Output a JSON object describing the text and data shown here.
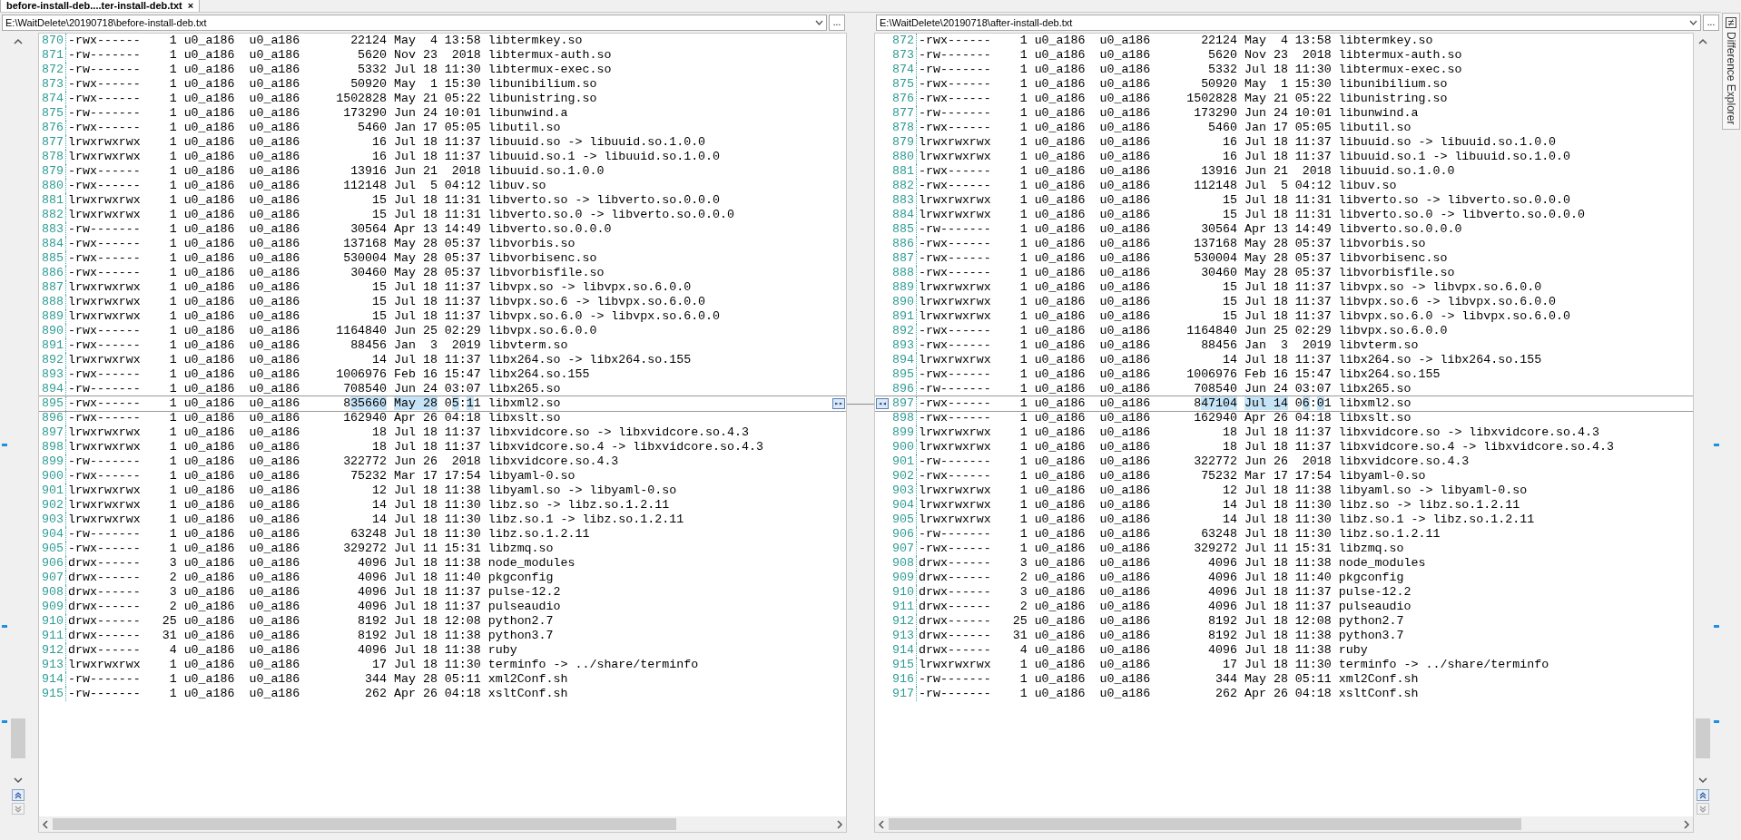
{
  "tab": {
    "title": "before-install-deb....ter-install-deb.txt",
    "close": "×",
    "selected": true
  },
  "panes": [
    {
      "path": "E:\\WaitDelete\\20190718\\before-install-deb.txt",
      "browse": "...",
      "rows": [
        {
          "n": "870",
          "perms": "-rwx------",
          "links": "1",
          "owner": "u0_a186",
          "group": "u0_a186",
          "size": "22124",
          "date": "May  4 13:58",
          "name": "libtermkey.so"
        },
        {
          "n": "871",
          "perms": "-rw-------",
          "links": "1",
          "owner": "u0_a186",
          "group": "u0_a186",
          "size": "5620",
          "date": "Nov 23  2018",
          "name": "libtermux-auth.so"
        },
        {
          "n": "872",
          "perms": "-rw-------",
          "links": "1",
          "owner": "u0_a186",
          "group": "u0_a186",
          "size": "5332",
          "date": "Jul 18 11:30",
          "name": "libtermux-exec.so"
        },
        {
          "n": "873",
          "perms": "-rwx------",
          "links": "1",
          "owner": "u0_a186",
          "group": "u0_a186",
          "size": "50920",
          "date": "May  1 15:30",
          "name": "libunibilium.so"
        },
        {
          "n": "874",
          "perms": "-rwx------",
          "links": "1",
          "owner": "u0_a186",
          "group": "u0_a186",
          "size": "1502828",
          "date": "May 21 05:22",
          "name": "libunistring.so"
        },
        {
          "n": "875",
          "perms": "-rw-------",
          "links": "1",
          "owner": "u0_a186",
          "group": "u0_a186",
          "size": "173290",
          "date": "Jun 24 10:01",
          "name": "libunwind.a"
        },
        {
          "n": "876",
          "perms": "-rwx------",
          "links": "1",
          "owner": "u0_a186",
          "group": "u0_a186",
          "size": "5460",
          "date": "Jan 17 05:05",
          "name": "libutil.so"
        },
        {
          "n": "877",
          "perms": "lrwxrwxrwx",
          "links": "1",
          "owner": "u0_a186",
          "group": "u0_a186",
          "size": "16",
          "date": "Jul 18 11:37",
          "name": "libuuid.so -> libuuid.so.1.0.0"
        },
        {
          "n": "878",
          "perms": "lrwxrwxrwx",
          "links": "1",
          "owner": "u0_a186",
          "group": "u0_a186",
          "size": "16",
          "date": "Jul 18 11:37",
          "name": "libuuid.so.1 -> libuuid.so.1.0.0"
        },
        {
          "n": "879",
          "perms": "-rwx------",
          "links": "1",
          "owner": "u0_a186",
          "group": "u0_a186",
          "size": "13916",
          "date": "Jun 21  2018",
          "name": "libuuid.so.1.0.0"
        },
        {
          "n": "880",
          "perms": "-rwx------",
          "links": "1",
          "owner": "u0_a186",
          "group": "u0_a186",
          "size": "112148",
          "date": "Jul  5 04:12",
          "name": "libuv.so"
        },
        {
          "n": "881",
          "perms": "lrwxrwxrwx",
          "links": "1",
          "owner": "u0_a186",
          "group": "u0_a186",
          "size": "15",
          "date": "Jul 18 11:31",
          "name": "libverto.so -> libverto.so.0.0.0"
        },
        {
          "n": "882",
          "perms": "lrwxrwxrwx",
          "links": "1",
          "owner": "u0_a186",
          "group": "u0_a186",
          "size": "15",
          "date": "Jul 18 11:31",
          "name": "libverto.so.0 -> libverto.so.0.0.0"
        },
        {
          "n": "883",
          "perms": "-rw-------",
          "links": "1",
          "owner": "u0_a186",
          "group": "u0_a186",
          "size": "30564",
          "date": "Apr 13 14:49",
          "name": "libverto.so.0.0.0"
        },
        {
          "n": "884",
          "perms": "-rwx------",
          "links": "1",
          "owner": "u0_a186",
          "group": "u0_a186",
          "size": "137168",
          "date": "May 28 05:37",
          "name": "libvorbis.so"
        },
        {
          "n": "885",
          "perms": "-rwx------",
          "links": "1",
          "owner": "u0_a186",
          "group": "u0_a186",
          "size": "530004",
          "date": "May 28 05:37",
          "name": "libvorbisenc.so"
        },
        {
          "n": "886",
          "perms": "-rwx------",
          "links": "1",
          "owner": "u0_a186",
          "group": "u0_a186",
          "size": "30460",
          "date": "May 28 05:37",
          "name": "libvorbisfile.so"
        },
        {
          "n": "887",
          "perms": "lrwxrwxrwx",
          "links": "1",
          "owner": "u0_a186",
          "group": "u0_a186",
          "size": "15",
          "date": "Jul 18 11:37",
          "name": "libvpx.so -> libvpx.so.6.0.0"
        },
        {
          "n": "888",
          "perms": "lrwxrwxrwx",
          "links": "1",
          "owner": "u0_a186",
          "group": "u0_a186",
          "size": "15",
          "date": "Jul 18 11:37",
          "name": "libvpx.so.6 -> libvpx.so.6.0.0"
        },
        {
          "n": "889",
          "perms": "lrwxrwxrwx",
          "links": "1",
          "owner": "u0_a186",
          "group": "u0_a186",
          "size": "15",
          "date": "Jul 18 11:37",
          "name": "libvpx.so.6.0 -> libvpx.so.6.0.0"
        },
        {
          "n": "890",
          "perms": "-rwx------",
          "links": "1",
          "owner": "u0_a186",
          "group": "u0_a186",
          "size": "1164840",
          "date": "Jun 25 02:29",
          "name": "libvpx.so.6.0.0"
        },
        {
          "n": "891",
          "perms": "-rwx------",
          "links": "1",
          "owner": "u0_a186",
          "group": "u0_a186",
          "size": "88456",
          "date": "Jan  3  2019",
          "name": "libvterm.so"
        },
        {
          "n": "892",
          "perms": "lrwxrwxrwx",
          "links": "1",
          "owner": "u0_a186",
          "group": "u0_a186",
          "size": "14",
          "date": "Jul 18 11:37",
          "name": "libx264.so -> libx264.so.155"
        },
        {
          "n": "893",
          "perms": "-rwx------",
          "links": "1",
          "owner": "u0_a186",
          "group": "u0_a186",
          "size": "1006976",
          "date": "Feb 16 15:47",
          "name": "libx264.so.155"
        },
        {
          "n": "894",
          "perms": "-rw-------",
          "links": "1",
          "owner": "u0_a186",
          "group": "u0_a186",
          "size": "708540",
          "date": "Jun 24 03:07",
          "name": "libx265.so"
        },
        {
          "n": "895",
          "perms": "-rwx------",
          "links": "1",
          "owner": "u0_a186",
          "group": "u0_a186",
          "changed": true,
          "size": [
            {
              "text": "8",
              "changed": false
            },
            {
              "text": "35660",
              "changed": true
            }
          ],
          "date": [
            {
              "text": "May 28",
              "changed": true
            },
            {
              "text": " 0",
              "changed": false
            },
            {
              "text": "5",
              "changed": true
            },
            {
              "text": ":",
              "changed": false
            },
            {
              "text": "1",
              "changed": true
            },
            {
              "text": "1",
              "changed": false
            }
          ],
          "name": "libxml2.so",
          "jump": "▸▸"
        },
        {
          "n": "896",
          "perms": "-rwx------",
          "links": "1",
          "owner": "u0_a186",
          "group": "u0_a186",
          "size": "162940",
          "date": "Apr 26 04:18",
          "name": "libxslt.so"
        },
        {
          "n": "897",
          "perms": "lrwxrwxrwx",
          "links": "1",
          "owner": "u0_a186",
          "group": "u0_a186",
          "size": "18",
          "date": "Jul 18 11:37",
          "name": "libxvidcore.so -> libxvidcore.so.4.3"
        },
        {
          "n": "898",
          "perms": "lrwxrwxrwx",
          "links": "1",
          "owner": "u0_a186",
          "group": "u0_a186",
          "size": "18",
          "date": "Jul 18 11:37",
          "name": "libxvidcore.so.4 -> libxvidcore.so.4.3"
        },
        {
          "n": "899",
          "perms": "-rw-------",
          "links": "1",
          "owner": "u0_a186",
          "group": "u0_a186",
          "size": "322772",
          "date": "Jun 26  2018",
          "name": "libxvidcore.so.4.3"
        },
        {
          "n": "900",
          "perms": "-rwx------",
          "links": "1",
          "owner": "u0_a186",
          "group": "u0_a186",
          "size": "75232",
          "date": "Mar 17 17:54",
          "name": "libyaml-0.so"
        },
        {
          "n": "901",
          "perms": "lrwxrwxrwx",
          "links": "1",
          "owner": "u0_a186",
          "group": "u0_a186",
          "size": "12",
          "date": "Jul 18 11:38",
          "name": "libyaml.so -> libyaml-0.so"
        },
        {
          "n": "902",
          "perms": "lrwxrwxrwx",
          "links": "1",
          "owner": "u0_a186",
          "group": "u0_a186",
          "size": "14",
          "date": "Jul 18 11:30",
          "name": "libz.so -> libz.so.1.2.11"
        },
        {
          "n": "903",
          "perms": "lrwxrwxrwx",
          "links": "1",
          "owner": "u0_a186",
          "group": "u0_a186",
          "size": "14",
          "date": "Jul 18 11:30",
          "name": "libz.so.1 -> libz.so.1.2.11"
        },
        {
          "n": "904",
          "perms": "-rw-------",
          "links": "1",
          "owner": "u0_a186",
          "group": "u0_a186",
          "size": "63248",
          "date": "Jul 18 11:30",
          "name": "libz.so.1.2.11"
        },
        {
          "n": "905",
          "perms": "-rwx------",
          "links": "1",
          "owner": "u0_a186",
          "group": "u0_a186",
          "size": "329272",
          "date": "Jul 11 15:31",
          "name": "libzmq.so"
        },
        {
          "n": "906",
          "perms": "drwx------",
          "links": "3",
          "owner": "u0_a186",
          "group": "u0_a186",
          "size": "4096",
          "date": "Jul 18 11:38",
          "name": "node_modules"
        },
        {
          "n": "907",
          "perms": "drwx------",
          "links": "2",
          "owner": "u0_a186",
          "group": "u0_a186",
          "size": "4096",
          "date": "Jul 18 11:40",
          "name": "pkgconfig"
        },
        {
          "n": "908",
          "perms": "drwx------",
          "links": "3",
          "owner": "u0_a186",
          "group": "u0_a186",
          "size": "4096",
          "date": "Jul 18 11:37",
          "name": "pulse-12.2"
        },
        {
          "n": "909",
          "perms": "drwx------",
          "links": "2",
          "owner": "u0_a186",
          "group": "u0_a186",
          "size": "4096",
          "date": "Jul 18 11:37",
          "name": "pulseaudio"
        },
        {
          "n": "910",
          "perms": "drwx------",
          "links": "25",
          "owner": "u0_a186",
          "group": "u0_a186",
          "size": "8192",
          "date": "Jul 18 12:08",
          "name": "python2.7"
        },
        {
          "n": "911",
          "perms": "drwx------",
          "links": "31",
          "owner": "u0_a186",
          "group": "u0_a186",
          "size": "8192",
          "date": "Jul 18 11:38",
          "name": "python3.7"
        },
        {
          "n": "912",
          "perms": "drwx------",
          "links": "4",
          "owner": "u0_a186",
          "group": "u0_a186",
          "size": "4096",
          "date": "Jul 18 11:38",
          "name": "ruby"
        },
        {
          "n": "913",
          "perms": "lrwxrwxrwx",
          "links": "1",
          "owner": "u0_a186",
          "group": "u0_a186",
          "size": "17",
          "date": "Jul 18 11:30",
          "name": "terminfo -> ../share/terminfo"
        },
        {
          "n": "914",
          "perms": "-rw-------",
          "links": "1",
          "owner": "u0_a186",
          "group": "u0_a186",
          "size": "344",
          "date": "May 28 05:11",
          "name": "xml2Conf.sh"
        },
        {
          "n": "915",
          "perms": "-rw-------",
          "links": "1",
          "owner": "u0_a186",
          "group": "u0_a186",
          "size": "262",
          "date": "Apr 26 04:18",
          "name": "xsltConf.sh"
        }
      ]
    },
    {
      "path": "E:\\WaitDelete\\20190718\\after-install-deb.txt",
      "browse": "...",
      "rows": [
        {
          "n": "872",
          "perms": "-rwx------",
          "links": "1",
          "owner": "u0_a186",
          "group": "u0_a186",
          "size": "22124",
          "date": "May  4 13:58",
          "name": "libtermkey.so"
        },
        {
          "n": "873",
          "perms": "-rw-------",
          "links": "1",
          "owner": "u0_a186",
          "group": "u0_a186",
          "size": "5620",
          "date": "Nov 23  2018",
          "name": "libtermux-auth.so"
        },
        {
          "n": "874",
          "perms": "-rw-------",
          "links": "1",
          "owner": "u0_a186",
          "group": "u0_a186",
          "size": "5332",
          "date": "Jul 18 11:30",
          "name": "libtermux-exec.so"
        },
        {
          "n": "875",
          "perms": "-rwx------",
          "links": "1",
          "owner": "u0_a186",
          "group": "u0_a186",
          "size": "50920",
          "date": "May  1 15:30",
          "name": "libunibilium.so"
        },
        {
          "n": "876",
          "perms": "-rwx------",
          "links": "1",
          "owner": "u0_a186",
          "group": "u0_a186",
          "size": "1502828",
          "date": "May 21 05:22",
          "name": "libunistring.so"
        },
        {
          "n": "877",
          "perms": "-rw-------",
          "links": "1",
          "owner": "u0_a186",
          "group": "u0_a186",
          "size": "173290",
          "date": "Jun 24 10:01",
          "name": "libunwind.a"
        },
        {
          "n": "878",
          "perms": "-rwx------",
          "links": "1",
          "owner": "u0_a186",
          "group": "u0_a186",
          "size": "5460",
          "date": "Jan 17 05:05",
          "name": "libutil.so"
        },
        {
          "n": "879",
          "perms": "lrwxrwxrwx",
          "links": "1",
          "owner": "u0_a186",
          "group": "u0_a186",
          "size": "16",
          "date": "Jul 18 11:37",
          "name": "libuuid.so -> libuuid.so.1.0.0"
        },
        {
          "n": "880",
          "perms": "lrwxrwxrwx",
          "links": "1",
          "owner": "u0_a186",
          "group": "u0_a186",
          "size": "16",
          "date": "Jul 18 11:37",
          "name": "libuuid.so.1 -> libuuid.so.1.0.0"
        },
        {
          "n": "881",
          "perms": "-rwx------",
          "links": "1",
          "owner": "u0_a186",
          "group": "u0_a186",
          "size": "13916",
          "date": "Jun 21  2018",
          "name": "libuuid.so.1.0.0"
        },
        {
          "n": "882",
          "perms": "-rwx------",
          "links": "1",
          "owner": "u0_a186",
          "group": "u0_a186",
          "size": "112148",
          "date": "Jul  5 04:12",
          "name": "libuv.so"
        },
        {
          "n": "883",
          "perms": "lrwxrwxrwx",
          "links": "1",
          "owner": "u0_a186",
          "group": "u0_a186",
          "size": "15",
          "date": "Jul 18 11:31",
          "name": "libverto.so -> libverto.so.0.0.0"
        },
        {
          "n": "884",
          "perms": "lrwxrwxrwx",
          "links": "1",
          "owner": "u0_a186",
          "group": "u0_a186",
          "size": "15",
          "date": "Jul 18 11:31",
          "name": "libverto.so.0 -> libverto.so.0.0.0"
        },
        {
          "n": "885",
          "perms": "-rw-------",
          "links": "1",
          "owner": "u0_a186",
          "group": "u0_a186",
          "size": "30564",
          "date": "Apr 13 14:49",
          "name": "libverto.so.0.0.0"
        },
        {
          "n": "886",
          "perms": "-rwx------",
          "links": "1",
          "owner": "u0_a186",
          "group": "u0_a186",
          "size": "137168",
          "date": "May 28 05:37",
          "name": "libvorbis.so"
        },
        {
          "n": "887",
          "perms": "-rwx------",
          "links": "1",
          "owner": "u0_a186",
          "group": "u0_a186",
          "size": "530004",
          "date": "May 28 05:37",
          "name": "libvorbisenc.so"
        },
        {
          "n": "888",
          "perms": "-rwx------",
          "links": "1",
          "owner": "u0_a186",
          "group": "u0_a186",
          "size": "30460",
          "date": "May 28 05:37",
          "name": "libvorbisfile.so"
        },
        {
          "n": "889",
          "perms": "lrwxrwxrwx",
          "links": "1",
          "owner": "u0_a186",
          "group": "u0_a186",
          "size": "15",
          "date": "Jul 18 11:37",
          "name": "libvpx.so -> libvpx.so.6.0.0"
        },
        {
          "n": "890",
          "perms": "lrwxrwxrwx",
          "links": "1",
          "owner": "u0_a186",
          "group": "u0_a186",
          "size": "15",
          "date": "Jul 18 11:37",
          "name": "libvpx.so.6 -> libvpx.so.6.0.0"
        },
        {
          "n": "891",
          "perms": "lrwxrwxrwx",
          "links": "1",
          "owner": "u0_a186",
          "group": "u0_a186",
          "size": "15",
          "date": "Jul 18 11:37",
          "name": "libvpx.so.6.0 -> libvpx.so.6.0.0"
        },
        {
          "n": "892",
          "perms": "-rwx------",
          "links": "1",
          "owner": "u0_a186",
          "group": "u0_a186",
          "size": "1164840",
          "date": "Jun 25 02:29",
          "name": "libvpx.so.6.0.0"
        },
        {
          "n": "893",
          "perms": "-rwx------",
          "links": "1",
          "owner": "u0_a186",
          "group": "u0_a186",
          "size": "88456",
          "date": "Jan  3  2019",
          "name": "libvterm.so"
        },
        {
          "n": "894",
          "perms": "lrwxrwxrwx",
          "links": "1",
          "owner": "u0_a186",
          "group": "u0_a186",
          "size": "14",
          "date": "Jul 18 11:37",
          "name": "libx264.so -> libx264.so.155"
        },
        {
          "n": "895",
          "perms": "-rwx------",
          "links": "1",
          "owner": "u0_a186",
          "group": "u0_a186",
          "size": "1006976",
          "date": "Feb 16 15:47",
          "name": "libx264.so.155"
        },
        {
          "n": "896",
          "perms": "-rw-------",
          "links": "1",
          "owner": "u0_a186",
          "group": "u0_a186",
          "size": "708540",
          "date": "Jun 24 03:07",
          "name": "libx265.so"
        },
        {
          "n": "897",
          "perms": "-rwx------",
          "links": "1",
          "owner": "u0_a186",
          "group": "u0_a186",
          "changed": true,
          "size": [
            {
              "text": "8",
              "changed": false
            },
            {
              "text": "47104",
              "changed": true
            }
          ],
          "date": [
            {
              "text": "Jul 14",
              "changed": true
            },
            {
              "text": " 0",
              "changed": false
            },
            {
              "text": "6",
              "changed": true
            },
            {
              "text": ":",
              "changed": false
            },
            {
              "text": "0",
              "changed": true
            },
            {
              "text": "1",
              "changed": false
            }
          ],
          "name": "libxml2.so",
          "jump": "◂◂"
        },
        {
          "n": "898",
          "perms": "-rwx------",
          "links": "1",
          "owner": "u0_a186",
          "group": "u0_a186",
          "size": "162940",
          "date": "Apr 26 04:18",
          "name": "libxslt.so"
        },
        {
          "n": "899",
          "perms": "lrwxrwxrwx",
          "links": "1",
          "owner": "u0_a186",
          "group": "u0_a186",
          "size": "18",
          "date": "Jul 18 11:37",
          "name": "libxvidcore.so -> libxvidcore.so.4.3"
        },
        {
          "n": "900",
          "perms": "lrwxrwxrwx",
          "links": "1",
          "owner": "u0_a186",
          "group": "u0_a186",
          "size": "18",
          "date": "Jul 18 11:37",
          "name": "libxvidcore.so.4 -> libxvidcore.so.4.3"
        },
        {
          "n": "901",
          "perms": "-rw-------",
          "links": "1",
          "owner": "u0_a186",
          "group": "u0_a186",
          "size": "322772",
          "date": "Jun 26  2018",
          "name": "libxvidcore.so.4.3"
        },
        {
          "n": "902",
          "perms": "-rwx------",
          "links": "1",
          "owner": "u0_a186",
          "group": "u0_a186",
          "size": "75232",
          "date": "Mar 17 17:54",
          "name": "libyaml-0.so"
        },
        {
          "n": "903",
          "perms": "lrwxrwxrwx",
          "links": "1",
          "owner": "u0_a186",
          "group": "u0_a186",
          "size": "12",
          "date": "Jul 18 11:38",
          "name": "libyaml.so -> libyaml-0.so"
        },
        {
          "n": "904",
          "perms": "lrwxrwxrwx",
          "links": "1",
          "owner": "u0_a186",
          "group": "u0_a186",
          "size": "14",
          "date": "Jul 18 11:30",
          "name": "libz.so -> libz.so.1.2.11"
        },
        {
          "n": "905",
          "perms": "lrwxrwxrwx",
          "links": "1",
          "owner": "u0_a186",
          "group": "u0_a186",
          "size": "14",
          "date": "Jul 18 11:30",
          "name": "libz.so.1 -> libz.so.1.2.11"
        },
        {
          "n": "906",
          "perms": "-rw-------",
          "links": "1",
          "owner": "u0_a186",
          "group": "u0_a186",
          "size": "63248",
          "date": "Jul 18 11:30",
          "name": "libz.so.1.2.11"
        },
        {
          "n": "907",
          "perms": "-rwx------",
          "links": "1",
          "owner": "u0_a186",
          "group": "u0_a186",
          "size": "329272",
          "date": "Jul 11 15:31",
          "name": "libzmq.so"
        },
        {
          "n": "908",
          "perms": "drwx------",
          "links": "3",
          "owner": "u0_a186",
          "group": "u0_a186",
          "size": "4096",
          "date": "Jul 18 11:38",
          "name": "node_modules"
        },
        {
          "n": "909",
          "perms": "drwx------",
          "links": "2",
          "owner": "u0_a186",
          "group": "u0_a186",
          "size": "4096",
          "date": "Jul 18 11:40",
          "name": "pkgconfig"
        },
        {
          "n": "910",
          "perms": "drwx------",
          "links": "3",
          "owner": "u0_a186",
          "group": "u0_a186",
          "size": "4096",
          "date": "Jul 18 11:37",
          "name": "pulse-12.2"
        },
        {
          "n": "911",
          "perms": "drwx------",
          "links": "2",
          "owner": "u0_a186",
          "group": "u0_a186",
          "size": "4096",
          "date": "Jul 18 11:37",
          "name": "pulseaudio"
        },
        {
          "n": "912",
          "perms": "drwx------",
          "links": "25",
          "owner": "u0_a186",
          "group": "u0_a186",
          "size": "8192",
          "date": "Jul 18 12:08",
          "name": "python2.7"
        },
        {
          "n": "913",
          "perms": "drwx------",
          "links": "31",
          "owner": "u0_a186",
          "group": "u0_a186",
          "size": "8192",
          "date": "Jul 18 11:38",
          "name": "python3.7"
        },
        {
          "n": "914",
          "perms": "drwx------",
          "links": "4",
          "owner": "u0_a186",
          "group": "u0_a186",
          "size": "4096",
          "date": "Jul 18 11:38",
          "name": "ruby"
        },
        {
          "n": "915",
          "perms": "lrwxrwxrwx",
          "links": "1",
          "owner": "u0_a186",
          "group": "u0_a186",
          "size": "17",
          "date": "Jul 18 11:30",
          "name": "terminfo -> ../share/terminfo"
        },
        {
          "n": "916",
          "perms": "-rw-------",
          "links": "1",
          "owner": "u0_a186",
          "group": "u0_a186",
          "size": "344",
          "date": "May 28 05:11",
          "name": "xml2Conf.sh"
        },
        {
          "n": "917",
          "perms": "-rw-------",
          "links": "1",
          "owner": "u0_a186",
          "group": "u0_a186",
          "size": "262",
          "date": "Apr 26 04:18",
          "name": "xsltConf.sh"
        }
      ]
    }
  ],
  "side_tab": {
    "label": "Difference Explorer"
  }
}
